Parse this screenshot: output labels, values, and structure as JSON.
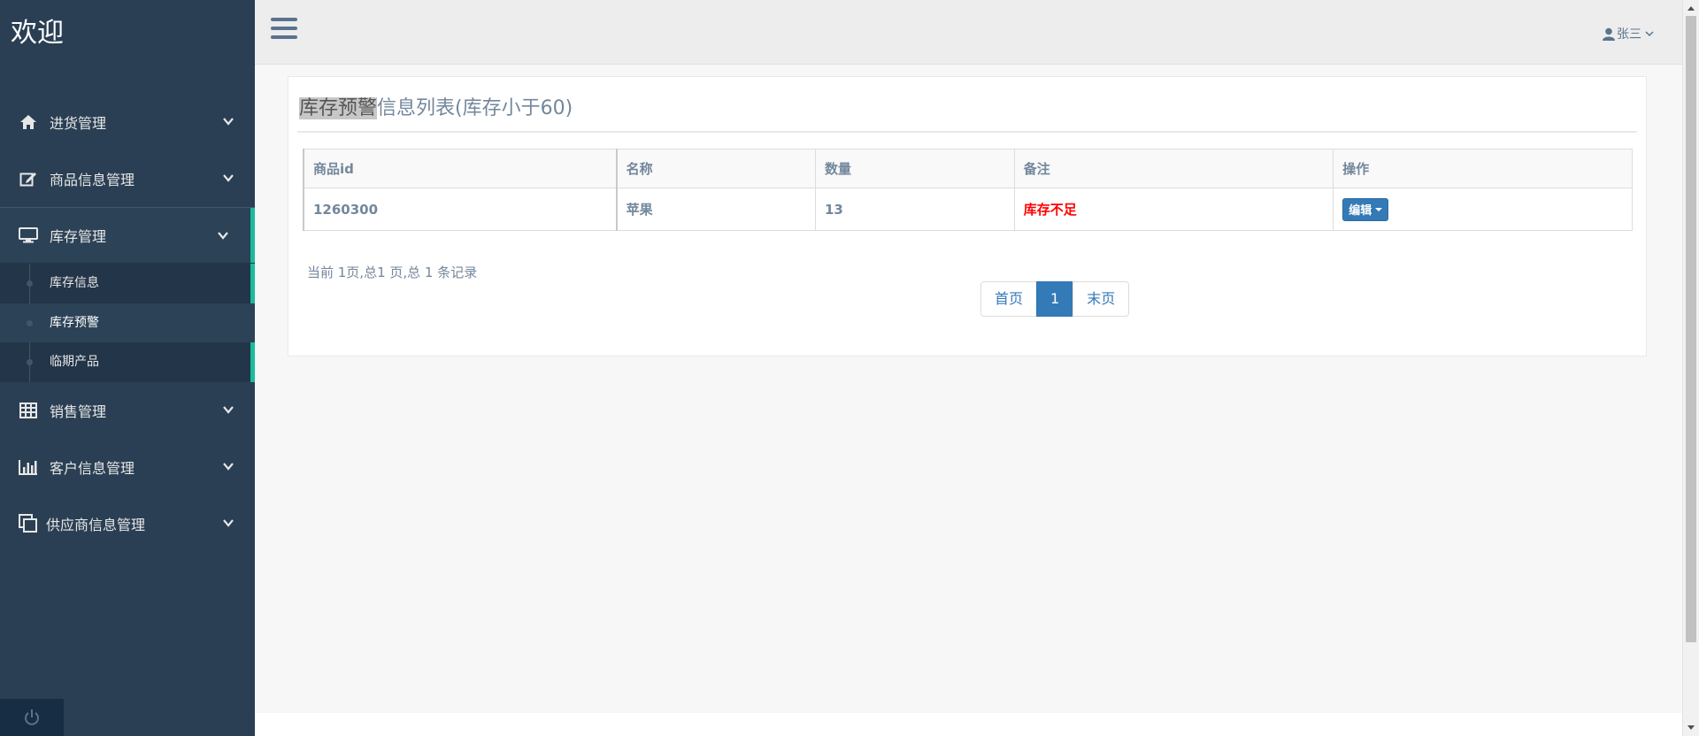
{
  "sidebar": {
    "brand": "欢迎",
    "menu": [
      {
        "label": "进货管理",
        "icon": "home-icon"
      },
      {
        "label": "商品信息管理",
        "icon": "edit-icon"
      },
      {
        "label": "库存管理",
        "icon": "desktop-icon"
      },
      {
        "label": "销售管理",
        "icon": "table-icon"
      },
      {
        "label": "客户信息管理",
        "icon": "bar-chart-icon"
      },
      {
        "label": "供应商信息管理",
        "icon": "copy-icon"
      }
    ],
    "inventory_submenu": [
      "库存信息",
      "库存预警",
      "临期产品"
    ],
    "footer_icon": "power-icon"
  },
  "topbar": {
    "user_name": "张三",
    "user_icon": "user-icon"
  },
  "panel": {
    "title_highlight": "库存预警",
    "title_rest": "信息列表(库存小于60)"
  },
  "table": {
    "headers": [
      "商品id",
      "名称",
      "数量",
      "备注",
      "操作"
    ],
    "rows": [
      {
        "id": "1260300",
        "name": "苹果",
        "qty": "13",
        "note": "库存不足",
        "action": "编辑"
      }
    ]
  },
  "pagination": {
    "info": "当前 1页,总1 页,总 1 条记录",
    "first": "首页",
    "current": "1",
    "last": "末页"
  },
  "colors": {
    "sidebar_bg": "#2a3f54",
    "accent": "#1abb9c",
    "primary": "#337ab7",
    "warn": "#ff0000"
  }
}
